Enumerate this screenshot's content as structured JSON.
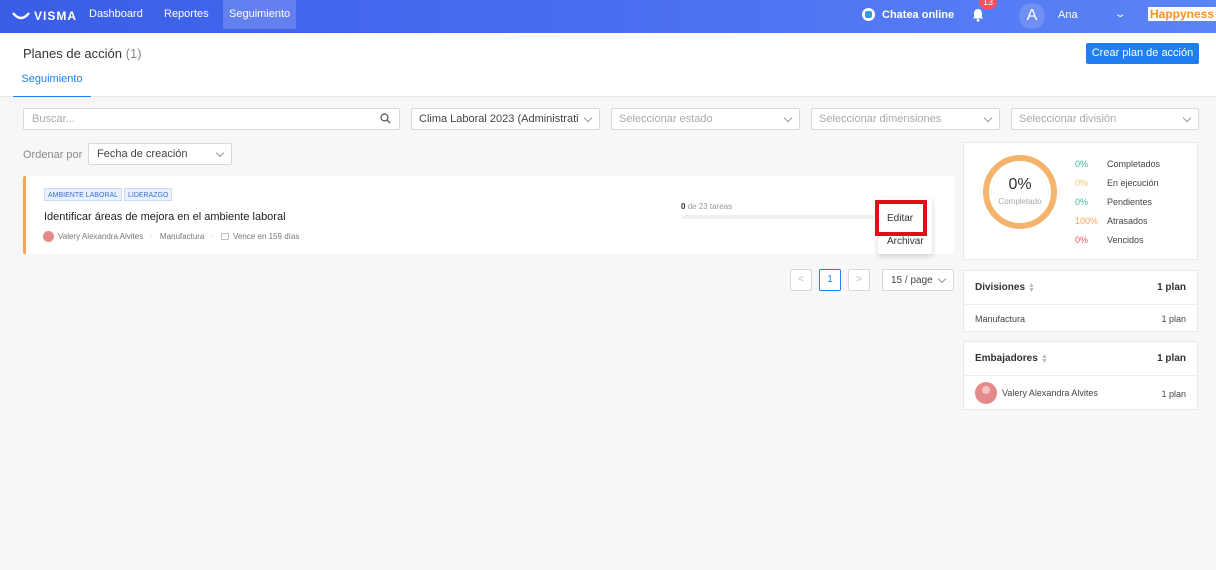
{
  "nav": {
    "logo": "VISMA",
    "links": [
      "Dashboard",
      "Reportes",
      "Seguimiento"
    ],
    "chat": "Chatea online",
    "notifications": "13",
    "avatar_letter": "A",
    "user": "Ana",
    "brand": "Happyness"
  },
  "header": {
    "title": "Planes de acción",
    "count": "(1)",
    "create_button": "Crear plan de acción",
    "tab": "Seguimiento"
  },
  "filters": {
    "search_placeholder": "Buscar...",
    "survey": "Clima Laboral 2023 (Administrati...",
    "state_placeholder": "Seleccionar estado",
    "dimensions_placeholder": "Seleccionar dimensiones",
    "division_placeholder": "Seleccionar división"
  },
  "sort": {
    "label": "Ordenar por",
    "value": "Fecha de creación"
  },
  "plan": {
    "tags": [
      "AMBIENTE LABORAL",
      "LIDERAZGO"
    ],
    "title": "Identificar áreas de mejora en el ambiente laboral",
    "owner": "Valery Alexandra Alvites",
    "division": "Manufactura",
    "due": "Vence en 159 días",
    "progress_done": "0",
    "progress_rest": "de 23 tareas",
    "progress_fraction": 0,
    "more_icon": "…"
  },
  "menu": {
    "edit": "Editar",
    "archive": "Archivar"
  },
  "pagination": {
    "prev": "<",
    "current": "1",
    "next": ">",
    "page_size": "15 / page"
  },
  "summary": {
    "percent": "0%",
    "label": "Completado",
    "rows": [
      {
        "pct": "0%",
        "label": "Completados",
        "color": "#3cb89a"
      },
      {
        "pct": "0%",
        "label": "En ejecución",
        "color": "#f5c66b"
      },
      {
        "pct": "0%",
        "label": "Pendientes",
        "color": "#3cb89a"
      },
      {
        "pct": "100%",
        "label": "Atrasados",
        "color": "#f5a65b"
      },
      {
        "pct": "0%",
        "label": "Vencidos",
        "color": "#f5515f"
      }
    ],
    "donut_color": "#f5b46e"
  },
  "divisiones": {
    "title": "Divisiones",
    "total": "1 plan",
    "row_label": "Manufactura",
    "row_value": "1 plan"
  },
  "embajadores": {
    "title": "Embajadores",
    "total": "1 plan",
    "row_label": "Valery Alexandra Alvites",
    "row_value": "1 plan"
  }
}
